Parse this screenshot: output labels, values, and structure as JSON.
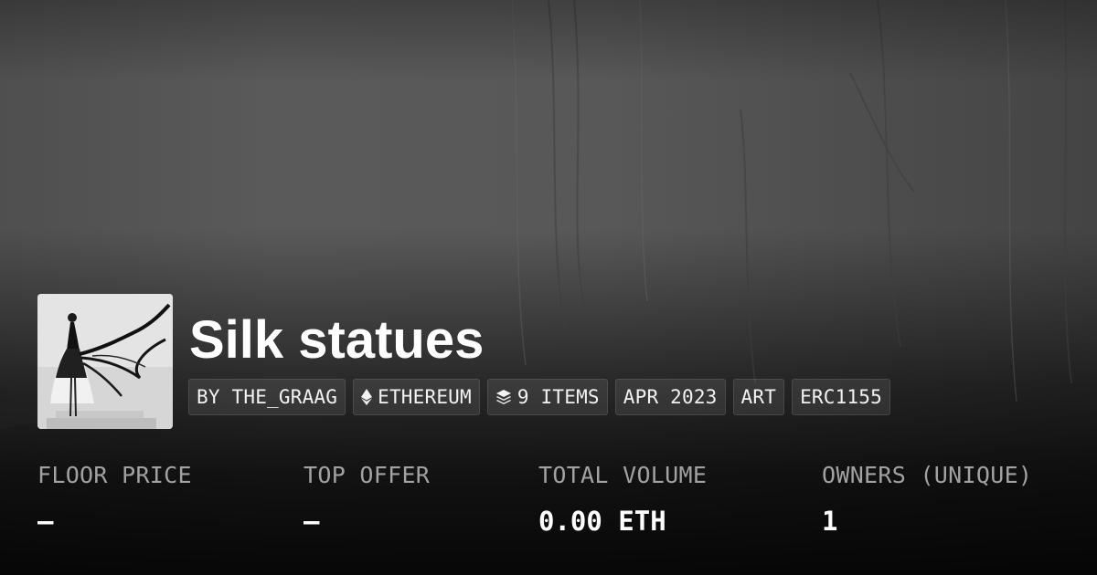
{
  "collection": {
    "title": "Silk statues",
    "thumbnail_alt": "silk statue artwork thumbnail"
  },
  "tags": {
    "creator": "BY THE_GRAAG",
    "chain": "ETHEREUM",
    "items": "9 ITEMS",
    "date": "APR 2023",
    "category": "ART",
    "standard": "ERC1155"
  },
  "stats": {
    "floor_price": {
      "label": "FLOOR PRICE",
      "value": "–"
    },
    "top_offer": {
      "label": "TOP OFFER",
      "value": "–"
    },
    "total_volume": {
      "label": "TOTAL VOLUME",
      "value": "0.00 ETH"
    },
    "owners": {
      "label": "OWNERS (UNIQUE)",
      "value": "1"
    }
  },
  "icons": {
    "chain": "ethereum-diamond-icon",
    "items": "layers-stack-icon"
  },
  "colors": {
    "text_primary": "#ffffff",
    "text_muted": "#a2a2a2",
    "tag_background": "rgba(255,255,255,0.09)"
  }
}
